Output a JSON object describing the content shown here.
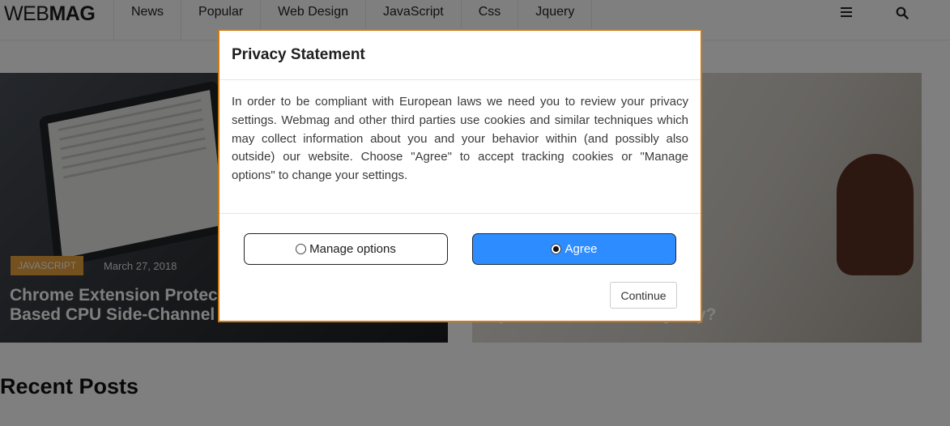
{
  "header": {
    "logo_light": "WEB",
    "logo_bold": "MAG",
    "nav": [
      "News",
      "Popular",
      "Web Design",
      "JavaScript",
      "Css",
      "Jquery"
    ],
    "icons": {
      "menu": "menu-icon",
      "search": "search-icon"
    }
  },
  "posts": [
    {
      "category": "JAVASCRIPT",
      "date": "March 27, 2018",
      "title": "Chrome Extension Protects Against JavaScript-Based CPU Side-Channel Attacks"
    },
    {
      "title": "Why Do You Still Use JQuery?"
    }
  ],
  "recent_posts_title": "Recent Posts",
  "modal": {
    "title": "Privacy Statement",
    "body": "In order to be compliant with European laws we need you to review your privacy settings. Webmag and other third parties use cookies and similar techniques which may collect information about you and your behavior within (and possibly also outside) our website. Choose \"Agree\" to accept tracking cookies or \"Manage options\" to change your settings.",
    "manage_label": "Manage options",
    "agree_label": "Agree",
    "selected_option": "Agree",
    "continue_label": "Continue"
  },
  "colors": {
    "accent": "#2d8cff",
    "modal_border": "#cc7a16",
    "badge": "#e8a33d"
  }
}
